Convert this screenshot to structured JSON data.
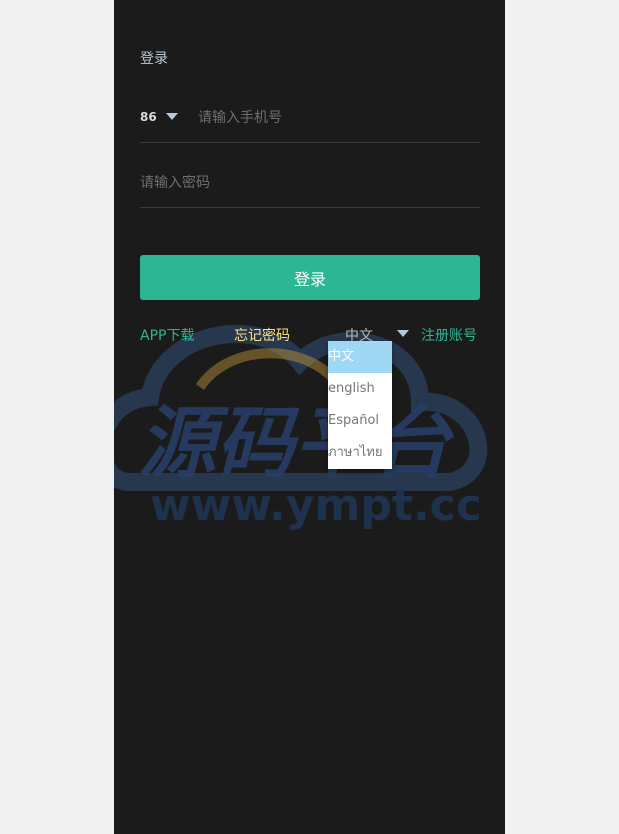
{
  "page": {
    "title": "登录"
  },
  "phone": {
    "country_code": "86",
    "placeholder": "请输入手机号"
  },
  "password": {
    "placeholder": "请输入密码"
  },
  "login_button": "登录",
  "links": {
    "app_download": "APP下载",
    "forgot_password": "忘记密码",
    "register": "注册账号"
  },
  "language": {
    "selected": "中文",
    "options": [
      "中文",
      "english",
      "Español",
      "ภาษาไทย"
    ]
  },
  "watermark": {
    "brand": "源码平台",
    "url": "www.ympt.cc"
  },
  "colors": {
    "accent": "#2db694",
    "forgot_link": "#ffe27a",
    "background": "#1b1b1b",
    "dropdown_selected": "#9fd8f5"
  }
}
